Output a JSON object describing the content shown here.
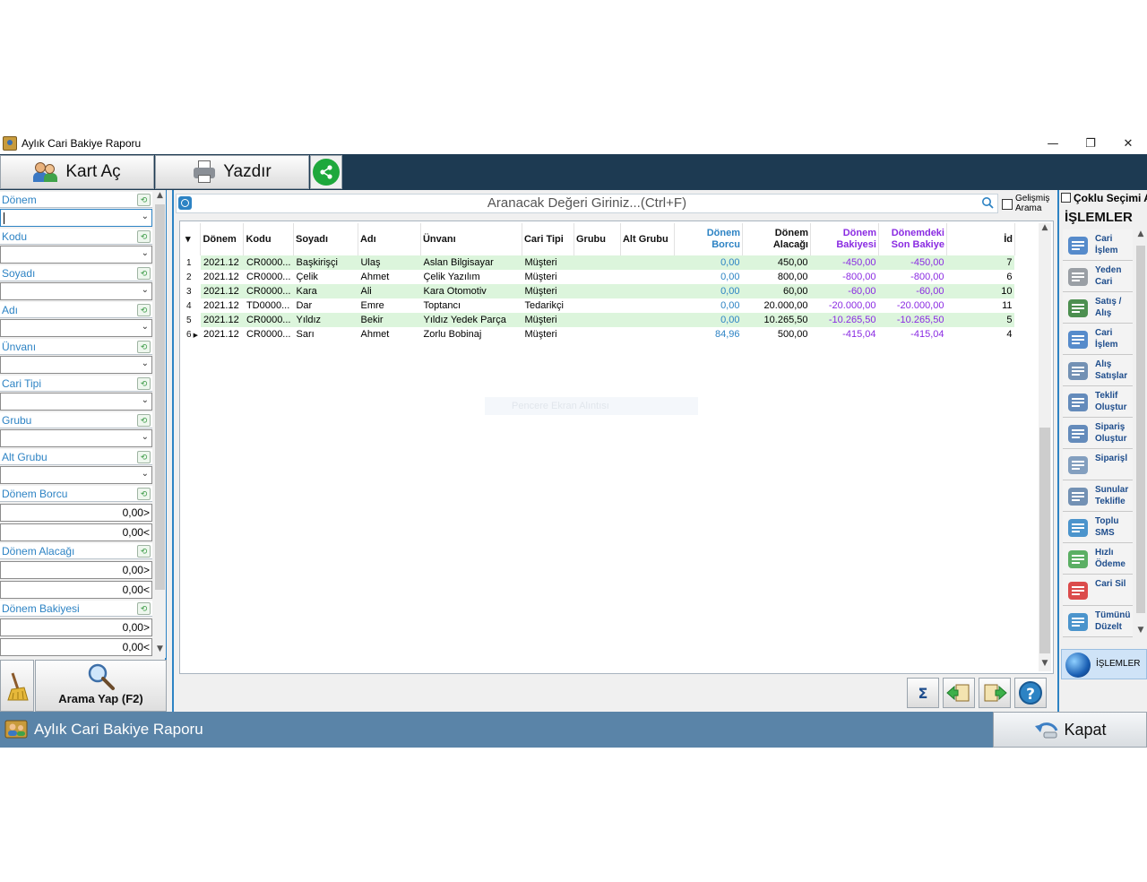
{
  "window": {
    "title": "Aylık Cari Bakiye Raporu",
    "minimize": "—",
    "restore": "❐",
    "close": "✕"
  },
  "toolbar": {
    "kart_ac": "Kart Aç",
    "yazdir": "Yazdır"
  },
  "filters": {
    "donem": "Dönem",
    "kodu": "Kodu",
    "soyadi": "Soyadı",
    "adi": "Adı",
    "unvani": "Ünvanı",
    "cari_tipi": "Cari Tipi",
    "grubu": "Grubu",
    "alt_grubu": "Alt Grubu",
    "donem_borcu": "Dönem Borcu",
    "donem_borcu_min": "0,00>",
    "donem_borcu_max": "0,00<",
    "donem_alacagi": "Dönem Alacağı",
    "donem_alacagi_min": "0,00>",
    "donem_alacagi_max": "0,00<",
    "donem_bakiyesi": "Dönem Bakiyesi",
    "donem_bakiyesi_min": "0,00>",
    "donem_bakiyesi_max": "0,00<",
    "search_button": "Arama Yap (F2)"
  },
  "search": {
    "placeholder": "Aranacak Değeri Giriniz...(Ctrl+F)",
    "advanced_l1": "Gelişmiş",
    "advanced_l2": "Arama"
  },
  "grid": {
    "headers": {
      "donem": "Dönem",
      "kodu": "Kodu",
      "soyadi": "Soyadı",
      "adi": "Adı",
      "unvani": "Ünvanı",
      "cari_tipi": "Cari Tipi",
      "grubu": "Grubu",
      "alt_grubu": "Alt Grubu",
      "donem_borcu": "Dönem Borcu",
      "donem_alacagi_l1": "Dönem",
      "donem_alacagi_l2": "Alacağı",
      "donem_bakiyesi_l1": "Dönem",
      "donem_bakiyesi_l2": "Bakiyesi",
      "son_bakiye_l1": "Dönemdeki",
      "son_bakiye_l2": "Son Bakiye",
      "id": "İd"
    },
    "rows": [
      {
        "n": "1",
        "donem": "2021.12",
        "kodu": "CR0000...",
        "soyadi": "Başkirişçi",
        "adi": "Ulaş",
        "unvani": "Aslan Bilgisayar",
        "cari_tipi": "Müşteri",
        "grubu": "",
        "alt_grubu": "",
        "borc": "0,00",
        "alacak": "450,00",
        "bakiye": "-450,00",
        "son_bakiye": "-450,00",
        "id": "7"
      },
      {
        "n": "2",
        "donem": "2021.12",
        "kodu": "CR0000...",
        "soyadi": "Çelik",
        "adi": "Ahmet",
        "unvani": "Çelik Yazılım",
        "cari_tipi": "Müşteri",
        "grubu": "",
        "alt_grubu": "",
        "borc": "0,00",
        "alacak": "800,00",
        "bakiye": "-800,00",
        "son_bakiye": "-800,00",
        "id": "6"
      },
      {
        "n": "3",
        "donem": "2021.12",
        "kodu": "CR0000...",
        "soyadi": "Kara",
        "adi": "Ali",
        "unvani": "Kara Otomotiv",
        "cari_tipi": "Müşteri",
        "grubu": "",
        "alt_grubu": "",
        "borc": "0,00",
        "alacak": "60,00",
        "bakiye": "-60,00",
        "son_bakiye": "-60,00",
        "id": "10"
      },
      {
        "n": "4",
        "donem": "2021.12",
        "kodu": "TD0000...",
        "soyadi": "Dar",
        "adi": "Emre",
        "unvani": "Toptancı",
        "cari_tipi": "Tedarikçi",
        "grubu": "",
        "alt_grubu": "",
        "borc": "0,00",
        "alacak": "20.000,00",
        "bakiye": "-20.000,00",
        "son_bakiye": "-20.000,00",
        "id": "11"
      },
      {
        "n": "5",
        "donem": "2021.12",
        "kodu": "CR0000...",
        "soyadi": "Yıldız",
        "adi": "Bekir",
        "unvani": "Yıldız Yedek Parça",
        "cari_tipi": "Müşteri",
        "grubu": "",
        "alt_grubu": "",
        "borc": "0,00",
        "alacak": "10.265,50",
        "bakiye": "-10.265,50",
        "son_bakiye": "-10.265,50",
        "id": "5"
      },
      {
        "n": "6",
        "donem": "2021.12",
        "kodu": "CR0000...",
        "soyadi": "Sarı",
        "adi": "Ahmet",
        "unvani": "Zorlu Bobinaj",
        "cari_tipi": "Müşteri",
        "grubu": "",
        "alt_grubu": "",
        "borc": "84,96",
        "alacak": "500,00",
        "bakiye": "-415,04",
        "son_bakiye": "-415,04",
        "id": "4"
      }
    ],
    "ghost_text": "Pencere Ekran Alıntısı"
  },
  "bottom_tools": {
    "sum": "Σ",
    "help": "?"
  },
  "right": {
    "multi_select": "Çoklu Seçimi A",
    "header": "İŞLEMLER",
    "ops": [
      {
        "l1": "Cari",
        "l2": "İşlem"
      },
      {
        "l1": "Yeden",
        "l2": "Cari"
      },
      {
        "l1": "Satış /",
        "l2": "Alış"
      },
      {
        "l1": "Cari",
        "l2": "İşlem"
      },
      {
        "l1": "Alış",
        "l2": "Satışlar"
      },
      {
        "l1": "Teklif",
        "l2": "Oluştur"
      },
      {
        "l1": "Sipariş",
        "l2": "Oluştur"
      },
      {
        "l1": "Siparişl",
        "l2": ""
      },
      {
        "l1": "Sunular",
        "l2": "Teklifle"
      },
      {
        "l1": "Toplu",
        "l2": "SMS"
      },
      {
        "l1": "Hızlı",
        "l2": "Ödeme"
      },
      {
        "l1": "Cari Sil",
        "l2": ""
      },
      {
        "l1": "Tümünü",
        "l2": "Düzelt"
      }
    ],
    "tab": "İŞLEMLER"
  },
  "status": {
    "title": "Aylık Cari Bakiye Raporu",
    "close": "Kapat"
  },
  "colors": {
    "accent_blue": "#2d83c4",
    "purple": "#8a2be2",
    "row_green": "#dcf5dc",
    "toolbar_dark": "#1d3a52",
    "status_bar": "#5a84a8"
  }
}
